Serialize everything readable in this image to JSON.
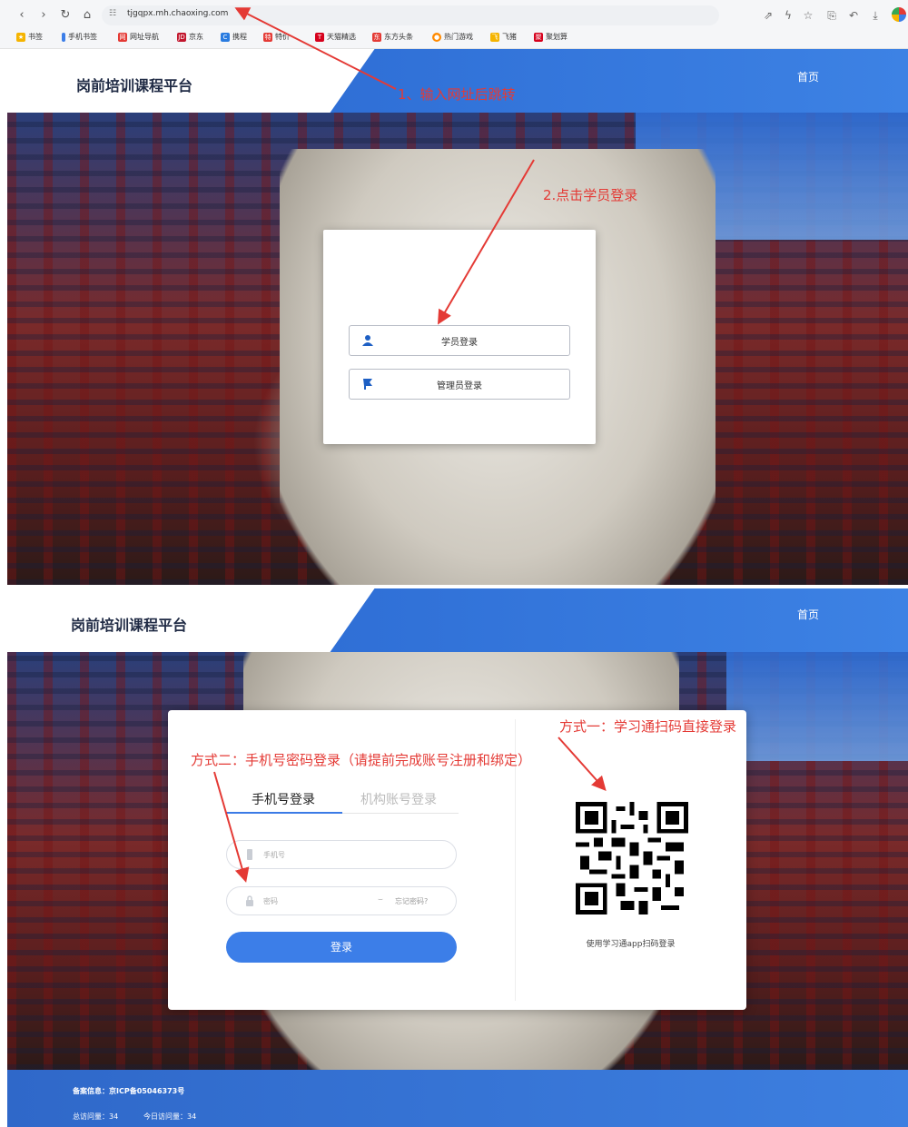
{
  "browser": {
    "url": "tjgqpx.mh.chaoxing.com",
    "bookmarks": [
      "书签",
      "手机书签",
      "网址导航",
      "京东",
      "携程",
      "特价",
      "天猫精选",
      "东方头条",
      "热门游戏",
      "飞猪",
      "聚划算"
    ]
  },
  "header": {
    "site_title": "岗前培训课程平台",
    "nav_home": "首页"
  },
  "choice_card": {
    "student_login": "学员登录",
    "admin_login": "管理员登录"
  },
  "login_form": {
    "tabs": [
      "手机号登录",
      "机构账号登录"
    ],
    "phone_placeholder": "手机号",
    "password_placeholder": "密码",
    "forgot_password": "忘记密码?",
    "submit_label": "登录",
    "qr_caption": "使用学习通app扫码登录"
  },
  "annotations": {
    "step1": "1、输入网址后跳转",
    "step2": "2.点击学员登录",
    "method1": "方式一：学习通扫码直接登录",
    "method2": "方式二：手机号密码登录（请提前完成账号注册和绑定）"
  },
  "footer": {
    "icp": "备案信息：京ICP备05046373号",
    "total_visits": "总访问量：34",
    "today_visits": "今日访问量：34"
  },
  "colors": {
    "accent_blue": "#3c7ee8",
    "annotation_red": "#e43a35",
    "header_blue": "#2f6fd6"
  }
}
